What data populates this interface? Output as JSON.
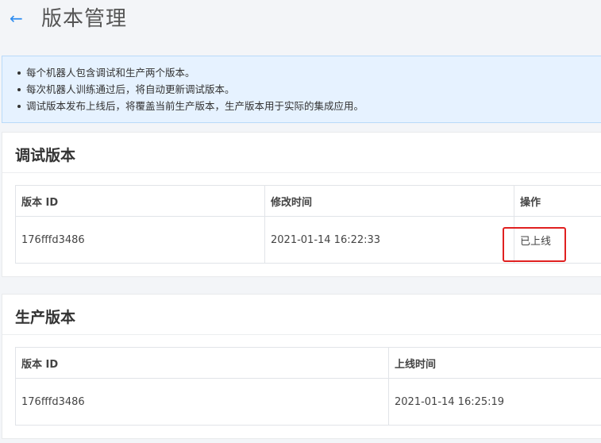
{
  "header": {
    "back_icon": "arrow-left-icon",
    "title": "版本管理"
  },
  "notice": {
    "items": [
      "每个机器人包含调试和生产两个版本。",
      "每次机器人训练通过后，将自动更新调试版本。",
      "调试版本发布上线后，将覆盖当前生产版本，生产版本用于实际的集成应用。"
    ]
  },
  "debug": {
    "title": "调试版本",
    "columns": [
      "版本 ID",
      "修改时间",
      "操作"
    ],
    "rows": [
      {
        "id": "176fffd3486",
        "time": "2021-01-14 16:22:33",
        "action": "已上线"
      }
    ]
  },
  "prod": {
    "title": "生产版本",
    "columns": [
      "版本 ID",
      "上线时间"
    ],
    "rows": [
      {
        "id": "176fffd3486",
        "time": "2021-01-14 16:25:19"
      }
    ]
  },
  "colors": {
    "accent": "#2d8cf0",
    "highlight": "#e02020",
    "notice_bg": "#e6f2ff"
  }
}
